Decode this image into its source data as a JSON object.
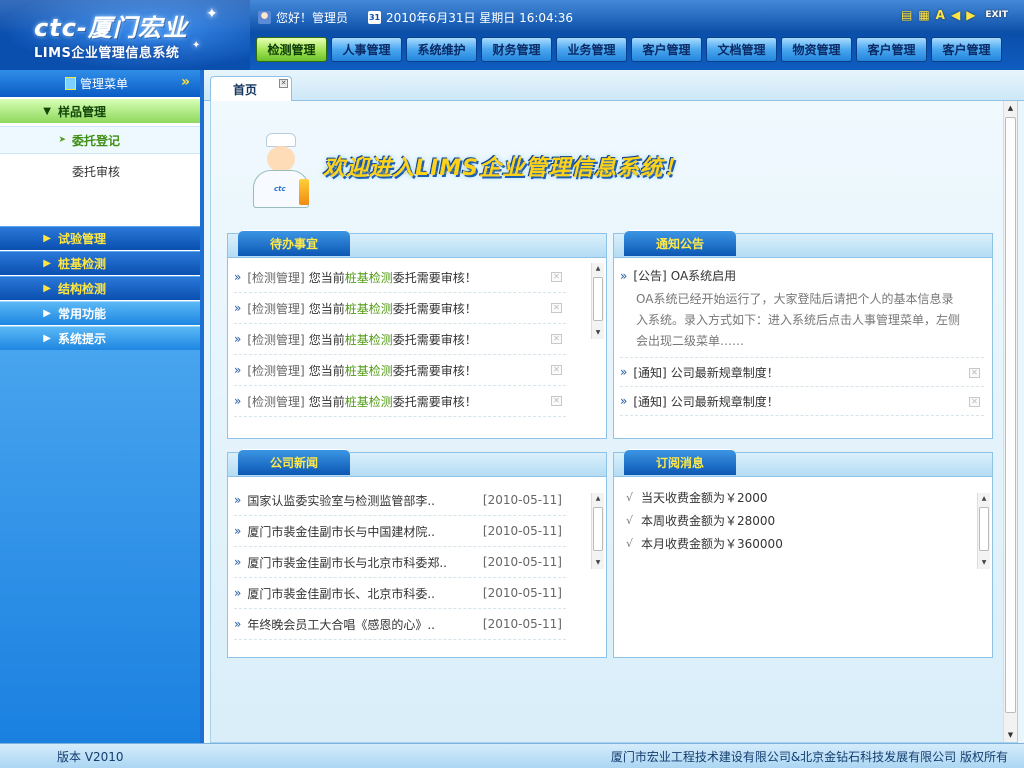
{
  "header": {
    "logo": "ctc-厦门宏业",
    "subtitle": "LIMS企业管理信息系统",
    "greeting": "您好！管理员",
    "datetime": "2010年6月31日 星期日 16:04:36",
    "exit_label": "EXIT",
    "calendar_digit": "31",
    "tool_font_glyph": "A"
  },
  "nav": {
    "items": [
      "检测管理",
      "人事管理",
      "系统维护",
      "财务管理",
      "业务管理",
      "客户管理",
      "文档管理",
      "物资管理",
      "客户管理",
      "客户管理"
    ],
    "active_index": 0
  },
  "sidebar": {
    "title": "管理菜单",
    "collapse_glyph": "»",
    "menus": [
      {
        "label": "样品管理",
        "state": "open",
        "sub": [
          "委托登记",
          "委托审核"
        ],
        "active_sub": 0
      },
      {
        "label": "试验管理",
        "state": "dark"
      },
      {
        "label": "桩基检测",
        "state": "dark"
      },
      {
        "label": "结构检测",
        "state": "dark"
      },
      {
        "label": "常用功能",
        "state": "light"
      },
      {
        "label": "系统提示",
        "state": "light"
      }
    ]
  },
  "tabs": [
    {
      "label": "首页"
    }
  ],
  "welcome": {
    "text": "欢迎进入LIMS企业管理信息系统！",
    "badge": "ctc"
  },
  "todo": {
    "title": "待办事宜",
    "items": [
      {
        "cat": "[检测管理]",
        "pre": "您当前",
        "hl": "桩基检测",
        "post": "委托需要审核！"
      },
      {
        "cat": "[检测管理]",
        "pre": "您当前",
        "hl": "桩基检测",
        "post": "委托需要审核！"
      },
      {
        "cat": "[检测管理]",
        "pre": "您当前",
        "hl": "桩基检测",
        "post": "委托需要审核！"
      },
      {
        "cat": "[检测管理]",
        "pre": "您当前",
        "hl": "桩基检测",
        "post": "委托需要审核！"
      },
      {
        "cat": "[检测管理]",
        "pre": "您当前",
        "hl": "桩基检测",
        "post": "委托需要审核！"
      }
    ]
  },
  "notice": {
    "title": "通知公告",
    "featured": {
      "tag": "[公告]",
      "title": "OA系统启用",
      "body": "OA系统已经开始运行了，大家登陆后请把个人的基本信息录入系统。录入方式如下：进入系统后点击人事管理菜单，左侧会出现二级菜单……"
    },
    "items": [
      {
        "tag": "[通知]",
        "title": "公司最新规章制度！"
      },
      {
        "tag": "[通知]",
        "title": "公司最新规章制度！"
      }
    ]
  },
  "news": {
    "title": "公司新闻",
    "items": [
      {
        "title": "国家认监委实验室与检测监管部李..",
        "date": "[2010-05-11]"
      },
      {
        "title": "厦门市裴金佳副市长与中国建材院..",
        "date": "[2010-05-11]"
      },
      {
        "title": "厦门市裴金佳副市长与北京市科委郑..",
        "date": "[2010-05-11]"
      },
      {
        "title": "厦门市裴金佳副市长、北京市科委..",
        "date": "[2010-05-11]"
      },
      {
        "title": "年终晚会员工大合唱《感恩的心》..",
        "date": "[2010-05-11]"
      }
    ]
  },
  "subscribe": {
    "title": "订阅消息",
    "items": [
      "当天收费金额为￥2000",
      "本周收费金额为￥28000",
      "本月收费金额为￥360000"
    ]
  },
  "footer": {
    "version": "版本 V2010",
    "copyright": "厦门市宏业工程技术建设有限公司&北京金钻石科技发展有限公司 版权所有"
  },
  "colors": {
    "accent": "#0a4ea8",
    "nav_active": "#a7e65a",
    "highlight": "#4f9b12",
    "title_yellow": "#ffe84a"
  }
}
